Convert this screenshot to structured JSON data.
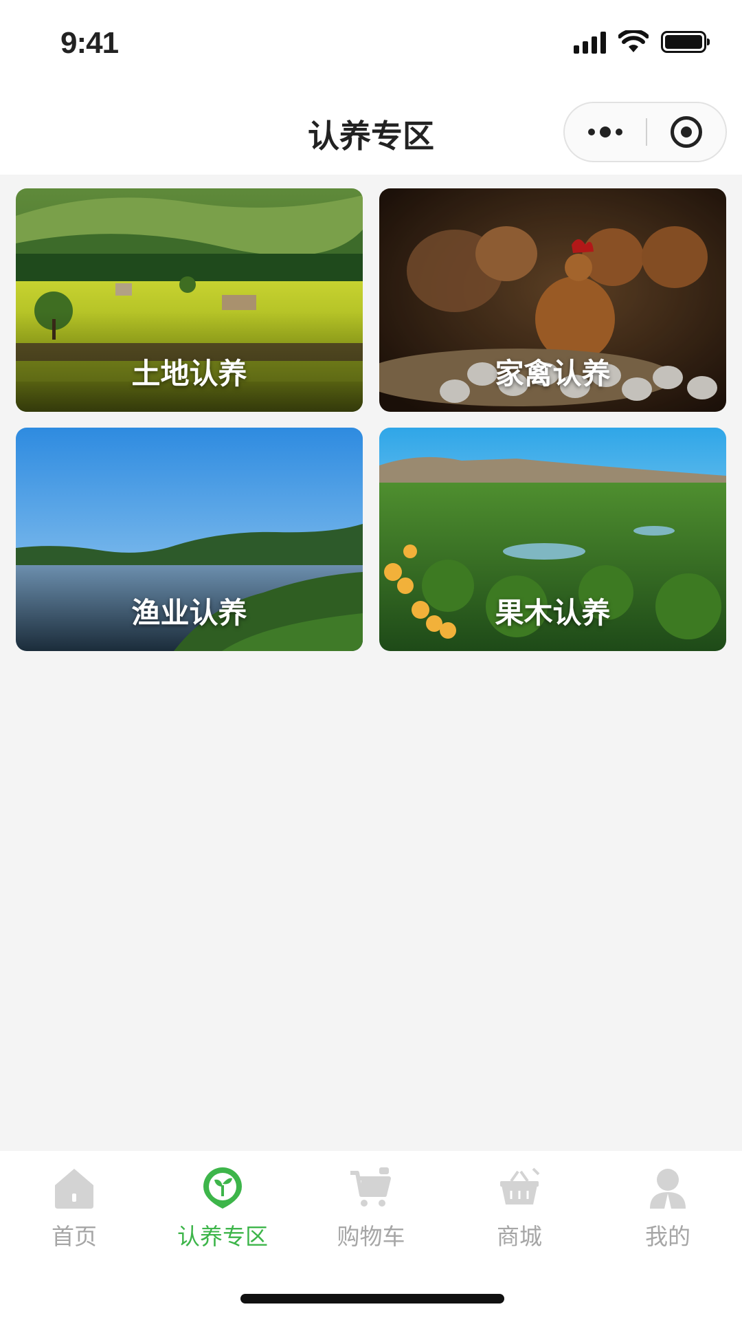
{
  "status_bar": {
    "time": "9:41"
  },
  "nav": {
    "title": "认养专区"
  },
  "cards": [
    {
      "label": "土地认养",
      "image": "farmland-landscape"
    },
    {
      "label": "家禽认养",
      "image": "hens-with-eggs"
    },
    {
      "label": "渔业认养",
      "image": "lake-with-forest"
    },
    {
      "label": "果木认养",
      "image": "orchard-valley"
    }
  ],
  "tab_bar": {
    "active_index": 1,
    "items": [
      {
        "label": "首页",
        "icon": "home-icon"
      },
      {
        "label": "认养专区",
        "icon": "sprout-pin-icon"
      },
      {
        "label": "购物车",
        "icon": "cart-icon"
      },
      {
        "label": "商城",
        "icon": "basket-icon"
      },
      {
        "label": "我的",
        "icon": "person-icon"
      }
    ]
  },
  "colors": {
    "accent": "#3db54a",
    "inactive": "#a6a6a6",
    "background": "#f4f4f4"
  }
}
